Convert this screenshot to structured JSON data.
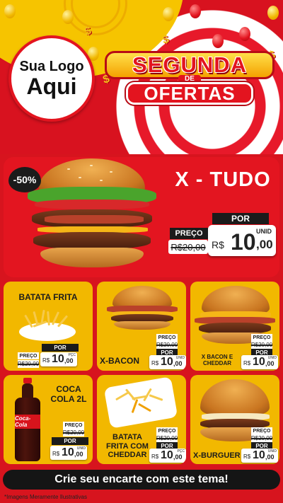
{
  "logo": {
    "line1": "Sua Logo",
    "line2": "Aqui"
  },
  "title": {
    "line1": "SEGUNDA",
    "connector": "DE",
    "line2": "OFERTAS"
  },
  "featured": {
    "discount": "-50%",
    "name": "X - TUDO",
    "old_label": "PREÇO",
    "old_price": "R$20,00",
    "new_label": "POR",
    "currency": "R$",
    "price_int": "10",
    "price_cents": ",00",
    "unit": "UNID"
  },
  "products": [
    {
      "name": "BATATA FRITA",
      "old_label": "PREÇO",
      "old_price": "R$20,00",
      "new_label": "POR",
      "currency": "R$",
      "price_int": "10",
      "price_cents": ",00",
      "unit": "PÇC"
    },
    {
      "name": "X-BACON",
      "old_label": "PREÇO",
      "old_price": "R$20,00",
      "new_label": "POR",
      "currency": "R$",
      "price_int": "10",
      "price_cents": ",00",
      "unit": "UNID"
    },
    {
      "name": "X BACON E CHEDDAR",
      "old_label": "PREÇO",
      "old_price": "R$20,00",
      "new_label": "POR",
      "currency": "R$",
      "price_int": "10",
      "price_cents": ",00",
      "unit": "UNID"
    },
    {
      "name": "COCA COLA 2L",
      "old_label": "PREÇO",
      "old_price": "R$20,00",
      "new_label": "POR",
      "currency": "R$",
      "price_int": "10",
      "price_cents": ",00",
      "unit": "UNID"
    },
    {
      "name": "BATATA FRITA COM CHEDDAR",
      "old_label": "PREÇO",
      "old_price": "R$20,00",
      "new_label": "POR",
      "currency": "R$",
      "price_int": "10",
      "price_cents": ",00",
      "unit": "PÇC"
    },
    {
      "name": "X-BURGUER",
      "old_label": "PREÇO",
      "old_price": "R$20,00",
      "new_label": "POR",
      "currency": "R$",
      "price_int": "10",
      "price_cents": ",00",
      "unit": "UNID"
    }
  ],
  "bottle_label": "Coca-Cola",
  "cta": "Crie seu encarte com este tema!",
  "footnote": "*Imagens Meramente Ilustrativas",
  "colors": {
    "primary_red": "#d8121f",
    "accent_yellow": "#f2b800",
    "dark": "#1b1b1b"
  }
}
